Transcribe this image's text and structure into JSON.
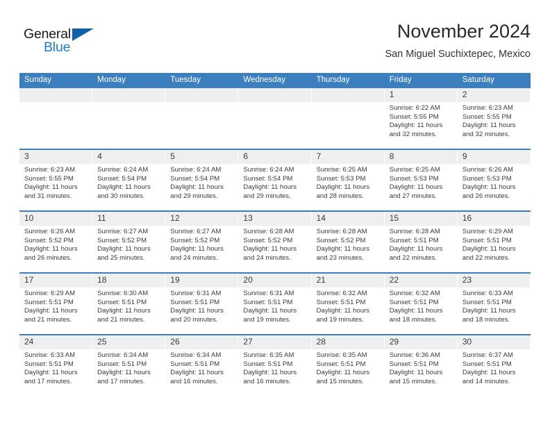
{
  "brand": {
    "name_part1": "General",
    "name_part2": "Blue",
    "triangle_icon": "triangle-icon",
    "accent_color": "#1f7cc4",
    "logo_triangle_color": "#1063a8"
  },
  "header": {
    "title": "November 2024",
    "subtitle": "San Miguel Suchixtepec, Mexico"
  },
  "calendar": {
    "header_bg": "#3c7fbf",
    "daynum_bg": "#efefef",
    "weekday_headers": [
      "Sunday",
      "Monday",
      "Tuesday",
      "Wednesday",
      "Thursday",
      "Friday",
      "Saturday"
    ],
    "labels": {
      "sunrise": "Sunrise:",
      "sunset": "Sunset:",
      "daylight": "Daylight:"
    },
    "weeks": [
      [
        {
          "day": "",
          "sunrise": "",
          "sunset": "",
          "daylight": ""
        },
        {
          "day": "",
          "sunrise": "",
          "sunset": "",
          "daylight": ""
        },
        {
          "day": "",
          "sunrise": "",
          "sunset": "",
          "daylight": ""
        },
        {
          "day": "",
          "sunrise": "",
          "sunset": "",
          "daylight": ""
        },
        {
          "day": "",
          "sunrise": "",
          "sunset": "",
          "daylight": ""
        },
        {
          "day": "1",
          "sunrise": "Sunrise: 6:22 AM",
          "sunset": "Sunset: 5:55 PM",
          "daylight": "Daylight: 11 hours and 32 minutes."
        },
        {
          "day": "2",
          "sunrise": "Sunrise: 6:23 AM",
          "sunset": "Sunset: 5:55 PM",
          "daylight": "Daylight: 11 hours and 32 minutes."
        }
      ],
      [
        {
          "day": "3",
          "sunrise": "Sunrise: 6:23 AM",
          "sunset": "Sunset: 5:55 PM",
          "daylight": "Daylight: 11 hours and 31 minutes."
        },
        {
          "day": "4",
          "sunrise": "Sunrise: 6:24 AM",
          "sunset": "Sunset: 5:54 PM",
          "daylight": "Daylight: 11 hours and 30 minutes."
        },
        {
          "day": "5",
          "sunrise": "Sunrise: 6:24 AM",
          "sunset": "Sunset: 5:54 PM",
          "daylight": "Daylight: 11 hours and 29 minutes."
        },
        {
          "day": "6",
          "sunrise": "Sunrise: 6:24 AM",
          "sunset": "Sunset: 5:54 PM",
          "daylight": "Daylight: 11 hours and 29 minutes."
        },
        {
          "day": "7",
          "sunrise": "Sunrise: 6:25 AM",
          "sunset": "Sunset: 5:53 PM",
          "daylight": "Daylight: 11 hours and 28 minutes."
        },
        {
          "day": "8",
          "sunrise": "Sunrise: 6:25 AM",
          "sunset": "Sunset: 5:53 PM",
          "daylight": "Daylight: 11 hours and 27 minutes."
        },
        {
          "day": "9",
          "sunrise": "Sunrise: 6:26 AM",
          "sunset": "Sunset: 5:53 PM",
          "daylight": "Daylight: 11 hours and 26 minutes."
        }
      ],
      [
        {
          "day": "10",
          "sunrise": "Sunrise: 6:26 AM",
          "sunset": "Sunset: 5:52 PM",
          "daylight": "Daylight: 11 hours and 26 minutes."
        },
        {
          "day": "11",
          "sunrise": "Sunrise: 6:27 AM",
          "sunset": "Sunset: 5:52 PM",
          "daylight": "Daylight: 11 hours and 25 minutes."
        },
        {
          "day": "12",
          "sunrise": "Sunrise: 6:27 AM",
          "sunset": "Sunset: 5:52 PM",
          "daylight": "Daylight: 11 hours and 24 minutes."
        },
        {
          "day": "13",
          "sunrise": "Sunrise: 6:28 AM",
          "sunset": "Sunset: 5:52 PM",
          "daylight": "Daylight: 11 hours and 24 minutes."
        },
        {
          "day": "14",
          "sunrise": "Sunrise: 6:28 AM",
          "sunset": "Sunset: 5:52 PM",
          "daylight": "Daylight: 11 hours and 23 minutes."
        },
        {
          "day": "15",
          "sunrise": "Sunrise: 6:28 AM",
          "sunset": "Sunset: 5:51 PM",
          "daylight": "Daylight: 11 hours and 22 minutes."
        },
        {
          "day": "16",
          "sunrise": "Sunrise: 6:29 AM",
          "sunset": "Sunset: 5:51 PM",
          "daylight": "Daylight: 11 hours and 22 minutes."
        }
      ],
      [
        {
          "day": "17",
          "sunrise": "Sunrise: 6:29 AM",
          "sunset": "Sunset: 5:51 PM",
          "daylight": "Daylight: 11 hours and 21 minutes."
        },
        {
          "day": "18",
          "sunrise": "Sunrise: 6:30 AM",
          "sunset": "Sunset: 5:51 PM",
          "daylight": "Daylight: 11 hours and 21 minutes."
        },
        {
          "day": "19",
          "sunrise": "Sunrise: 6:31 AM",
          "sunset": "Sunset: 5:51 PM",
          "daylight": "Daylight: 11 hours and 20 minutes."
        },
        {
          "day": "20",
          "sunrise": "Sunrise: 6:31 AM",
          "sunset": "Sunset: 5:51 PM",
          "daylight": "Daylight: 11 hours and 19 minutes."
        },
        {
          "day": "21",
          "sunrise": "Sunrise: 6:32 AM",
          "sunset": "Sunset: 5:51 PM",
          "daylight": "Daylight: 11 hours and 19 minutes."
        },
        {
          "day": "22",
          "sunrise": "Sunrise: 6:32 AM",
          "sunset": "Sunset: 5:51 PM",
          "daylight": "Daylight: 11 hours and 18 minutes."
        },
        {
          "day": "23",
          "sunrise": "Sunrise: 6:33 AM",
          "sunset": "Sunset: 5:51 PM",
          "daylight": "Daylight: 11 hours and 18 minutes."
        }
      ],
      [
        {
          "day": "24",
          "sunrise": "Sunrise: 6:33 AM",
          "sunset": "Sunset: 5:51 PM",
          "daylight": "Daylight: 11 hours and 17 minutes."
        },
        {
          "day": "25",
          "sunrise": "Sunrise: 6:34 AM",
          "sunset": "Sunset: 5:51 PM",
          "daylight": "Daylight: 11 hours and 17 minutes."
        },
        {
          "day": "26",
          "sunrise": "Sunrise: 6:34 AM",
          "sunset": "Sunset: 5:51 PM",
          "daylight": "Daylight: 11 hours and 16 minutes."
        },
        {
          "day": "27",
          "sunrise": "Sunrise: 6:35 AM",
          "sunset": "Sunset: 5:51 PM",
          "daylight": "Daylight: 11 hours and 16 minutes."
        },
        {
          "day": "28",
          "sunrise": "Sunrise: 6:35 AM",
          "sunset": "Sunset: 5:51 PM",
          "daylight": "Daylight: 11 hours and 15 minutes."
        },
        {
          "day": "29",
          "sunrise": "Sunrise: 6:36 AM",
          "sunset": "Sunset: 5:51 PM",
          "daylight": "Daylight: 11 hours and 15 minutes."
        },
        {
          "day": "30",
          "sunrise": "Sunrise: 6:37 AM",
          "sunset": "Sunset: 5:51 PM",
          "daylight": "Daylight: 11 hours and 14 minutes."
        }
      ]
    ]
  }
}
